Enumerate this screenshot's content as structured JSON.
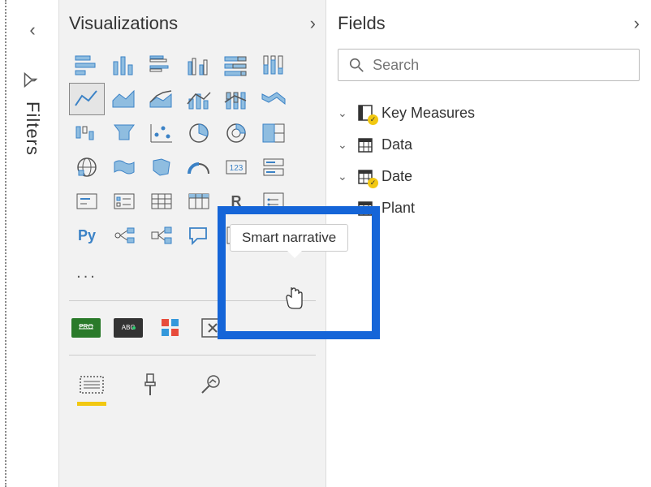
{
  "filters": {
    "label": "Filters"
  },
  "visualizations": {
    "title": "Visualizations",
    "tooltip_text": "Smart narrative",
    "icons": [
      "stacked-bar",
      "stacked-column",
      "clustered-bar",
      "clustered-column",
      "100-bar",
      "100-column",
      "line",
      "area",
      "stacked-area",
      "line-column",
      "line-stacked-column",
      "ribbon",
      "waterfall",
      "funnel",
      "scatter",
      "pie",
      "donut",
      "treemap",
      "map",
      "filled-map",
      "shape-map",
      "gauge",
      "card",
      "multi-row-card",
      "kpi",
      "slicer",
      "table",
      "matrix",
      "r-visual",
      "r-script",
      "python",
      "key-influencers",
      "decomposition-tree",
      "qa",
      "smart-narrative",
      "paginated"
    ],
    "selected_index": 6,
    "pills": [
      "arcgis",
      "power-apps",
      "more-visuals",
      "remove"
    ],
    "tabs": [
      "fields-tab",
      "format-tab",
      "analytics-tab"
    ],
    "active_tab": 0
  },
  "fields": {
    "title": "Fields",
    "search_placeholder": "Search",
    "items": [
      {
        "label": "Key Measures",
        "icon": "measures",
        "badge": true
      },
      {
        "label": "Data",
        "icon": "table",
        "badge": false
      },
      {
        "label": "Date",
        "icon": "table",
        "badge": true
      },
      {
        "label": "Plant",
        "icon": "table",
        "badge": false
      }
    ]
  },
  "colors": {
    "accent_blue": "#3B82C6",
    "accent_blue_fill": "#8FBDE0",
    "highlight": "#1565D8",
    "yellow": "#F2C811",
    "gray": "#555"
  }
}
